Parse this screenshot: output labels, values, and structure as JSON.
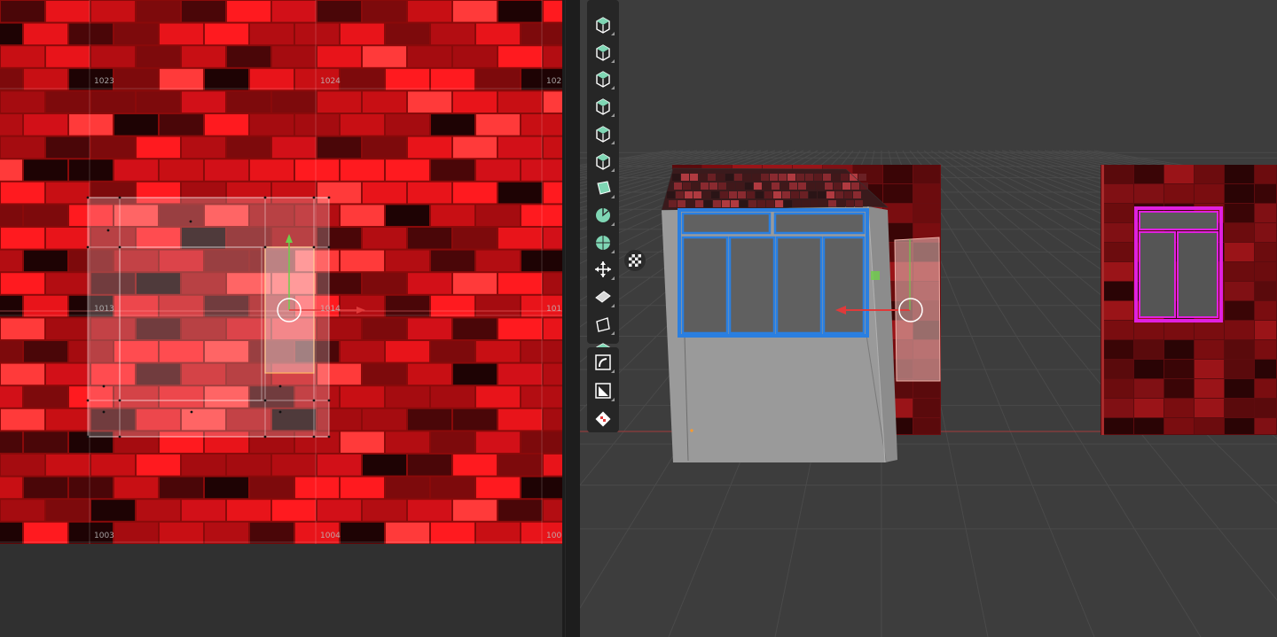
{
  "uv_editor": {
    "tile_labels": {
      "t1023": "1023",
      "t1024": "1024",
      "t1025": "102",
      "t1013": "1013",
      "t1014": "1014",
      "t1015": "101",
      "t1003": "1003",
      "t1004": "1004",
      "t1005": "100"
    }
  },
  "colors": {
    "uv_background": "#8a0a0a",
    "brick_red": "#e0141a",
    "uv_selection": "#ffffff",
    "viewport_background": "#3d3d3d",
    "toolbar_background": "#262626",
    "tool_icon": "#7fd6b4",
    "window_frame_blue": "#2a7fe0",
    "window_frame_magenta": "#e020e0",
    "gizmo_x": "#e03a3a",
    "gizmo_y": "#6fce4a"
  },
  "toolbar": {
    "tools": [
      {
        "name": "add-cube-tool",
        "icon": "cube-add-icon"
      },
      {
        "name": "extrude-region-tool",
        "icon": "extrude-icon"
      },
      {
        "name": "inset-faces-tool",
        "icon": "inset-icon"
      },
      {
        "name": "bevel-tool",
        "icon": "bevel-icon"
      },
      {
        "name": "loop-cut-tool",
        "icon": "loop-cut-icon"
      },
      {
        "name": "knife-tool",
        "icon": "knife-icon"
      },
      {
        "name": "poly-build-tool",
        "icon": "poly-build-icon"
      },
      {
        "name": "spin-tool",
        "icon": "spin-icon"
      },
      {
        "name": "smooth-tool",
        "icon": "smooth-icon"
      },
      {
        "name": "edge-slide-tool",
        "icon": "edge-slide-icon"
      },
      {
        "name": "shrink-fatten-tool",
        "icon": "shrink-fatten-icon"
      },
      {
        "name": "shear-tool",
        "icon": "shear-icon"
      },
      {
        "name": "rip-region-tool",
        "icon": "rip-icon"
      }
    ],
    "tools_extra": [
      {
        "name": "curve-tool",
        "icon": "curve-icon"
      },
      {
        "name": "uv-project-tool",
        "icon": "uv-project-icon"
      },
      {
        "name": "checker-tool",
        "icon": "checker-icon"
      }
    ]
  }
}
